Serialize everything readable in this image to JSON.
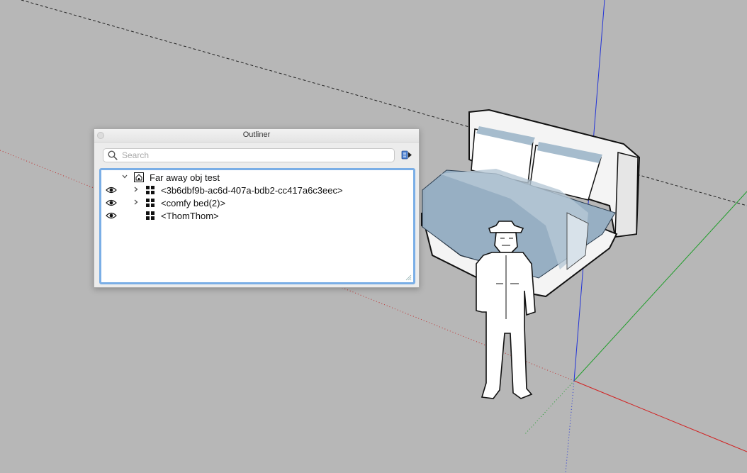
{
  "outliner": {
    "title": "Outliner",
    "search": {
      "placeholder": "Search",
      "value": ""
    },
    "tree": {
      "root": {
        "label": "Far away obj test",
        "icon": "model-icon",
        "expanded": true
      },
      "items": [
        {
          "label": "<3b6dbf9b-ac6d-407a-bdb2-cc417a6c3eec>",
          "visible": true,
          "expandable": true,
          "icon": "component-icon"
        },
        {
          "label": "<comfy bed(2)>",
          "visible": true,
          "expandable": true,
          "icon": "component-icon"
        },
        {
          "label": "<ThomThom>",
          "visible": true,
          "expandable": false,
          "icon": "component-icon"
        }
      ]
    }
  },
  "colors": {
    "background": "#b7b7b7",
    "axis_red": "#d21f1f",
    "axis_green": "#1f9d2a",
    "axis_blue": "#2233d8",
    "selection_border": "#7aaee6",
    "bed_fabric": "#97afc3"
  }
}
